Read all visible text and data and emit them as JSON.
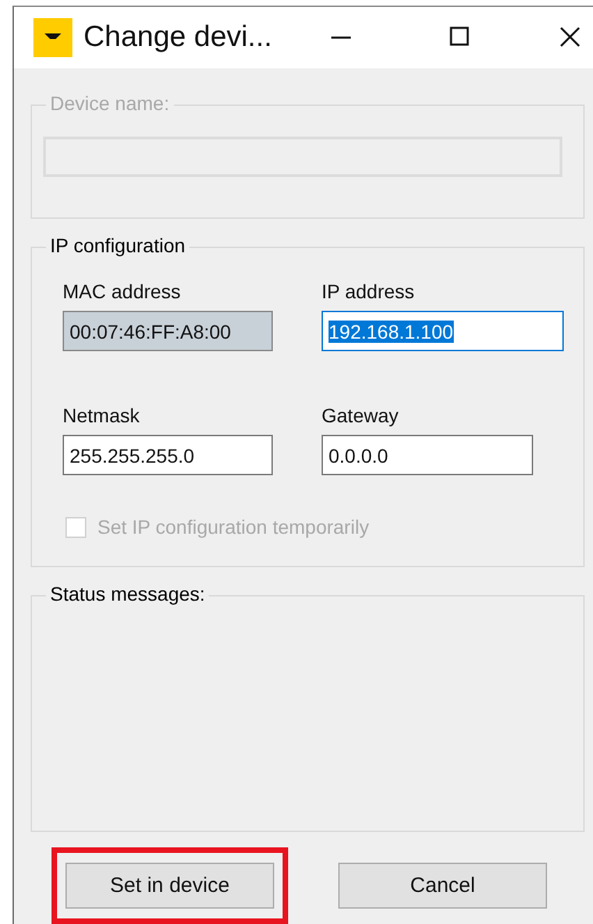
{
  "window": {
    "title": "Change devi..."
  },
  "device_name": {
    "label": "Device name:",
    "disabled": true
  },
  "ip_configuration": {
    "label": "IP configuration",
    "fields": [
      {
        "label": "MAC address",
        "value": "00:07:46:FF:A8:00",
        "readonly": true,
        "focused": false
      },
      {
        "label": "IP address",
        "value": "192.168.1.100",
        "readonly": false,
        "focused": true
      },
      {
        "label": "Netmask",
        "value": "255.255.255.0",
        "readonly": false,
        "focused": false
      },
      {
        "label": "Gateway",
        "value": "0.0.0.0",
        "readonly": false,
        "focused": false
      }
    ],
    "temporary": {
      "label": "Set IP configuration temporarily",
      "checked": false,
      "disabled": true
    }
  },
  "status_messages": {
    "label": "Status messages:"
  },
  "buttons": [
    {
      "label": "Set in device",
      "highlighted": true
    },
    {
      "label": "Cancel",
      "highlighted": false
    }
  ]
}
